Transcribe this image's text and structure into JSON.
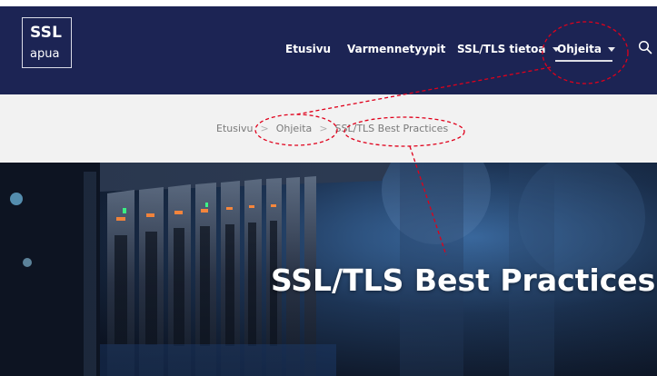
{
  "logo": {
    "line1": "SSL",
    "line2": "apua"
  },
  "nav": {
    "items": [
      {
        "label": "Etusivu"
      },
      {
        "label": "Varmennetyypit"
      },
      {
        "label": "SSL/TLS tietoa"
      },
      {
        "label": "Ohjeita"
      }
    ]
  },
  "breadcrumb": {
    "items": [
      "Etusivu",
      "Ohjeita",
      "SSL/TLS Best Practices"
    ],
    "separator": ">"
  },
  "hero": {
    "title": "SSL/TLS Best Practices"
  },
  "colors": {
    "header_bg": "#1c2454",
    "band_bg": "#f2f2f2",
    "annotation": "#e0001b"
  }
}
